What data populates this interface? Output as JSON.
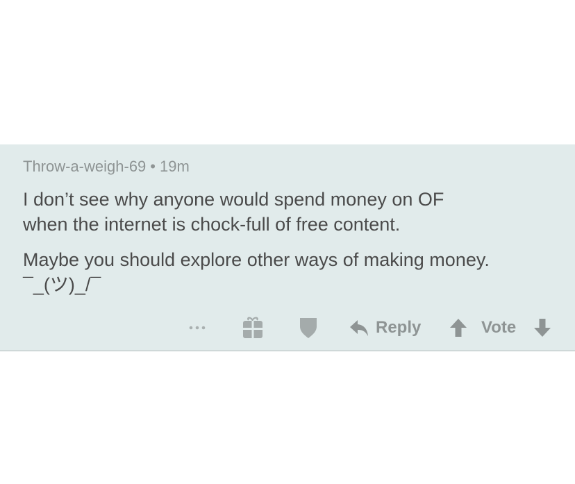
{
  "comment": {
    "author": "Throw-a-weigh-69",
    "separator": "•",
    "age": "19m",
    "paragraph1_line1": "I don’t see why anyone would spend money on OF",
    "paragraph1_line2": "when the internet is chock-full of free content.",
    "paragraph2_line1": "Maybe you should explore other ways of making money.",
    "paragraph2_line2": "¯_(ツ)_/¯"
  },
  "actions": {
    "more_icon": "more-horizontal-icon",
    "gift_icon": "gift-icon",
    "shield_icon": "shield-icon",
    "reply_icon": "reply-arrow-icon",
    "reply_label": "Reply",
    "upvote_icon": "arrow-up-icon",
    "vote_label": "Vote",
    "downvote_icon": "arrow-down-icon"
  },
  "colors": {
    "comment_bg": "#e1ebeb",
    "text": "#4a4a4a",
    "muted": "#8e9494"
  }
}
